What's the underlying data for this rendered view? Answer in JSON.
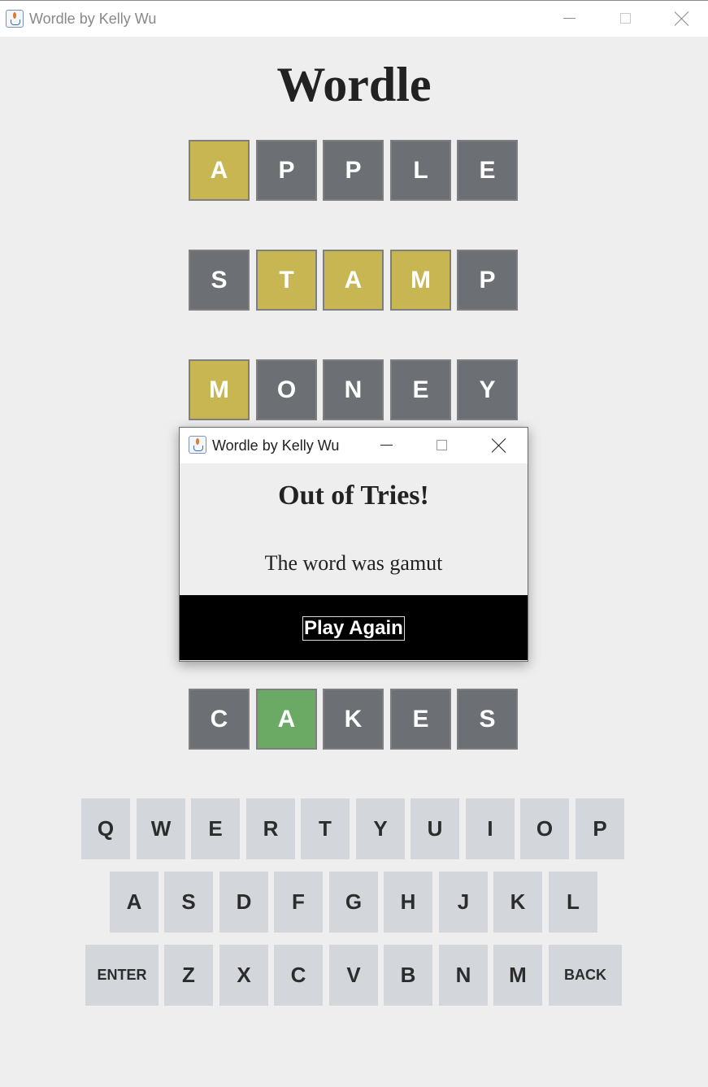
{
  "window": {
    "title": "Wordle by Kelly Wu"
  },
  "heading": "Wordle",
  "colors": {
    "yellow": "#c8b653",
    "gray": "#6c6f73",
    "green": "#6aaa64",
    "key_bg": "#d3d6da"
  },
  "grid": {
    "row1": [
      "A",
      "P",
      "P",
      "L",
      "E"
    ],
    "row2": [
      "S",
      "T",
      "A",
      "M",
      "P"
    ],
    "row3": [
      "M",
      "O",
      "N",
      "E",
      "Y"
    ],
    "row6": [
      "C",
      "A",
      "K",
      "E",
      "S"
    ]
  },
  "keyboard": {
    "row1": [
      "Q",
      "W",
      "E",
      "R",
      "T",
      "Y",
      "U",
      "I",
      "O",
      "P"
    ],
    "row2": [
      "A",
      "S",
      "D",
      "F",
      "G",
      "H",
      "J",
      "K",
      "L"
    ],
    "row3": [
      "ENTER",
      "Z",
      "X",
      "C",
      "V",
      "B",
      "N",
      "M",
      "BACK"
    ]
  },
  "dialog": {
    "title": "Wordle by Kelly Wu",
    "heading": "Out of Tries!",
    "message": "The word was gamut",
    "button": "Play Again"
  }
}
